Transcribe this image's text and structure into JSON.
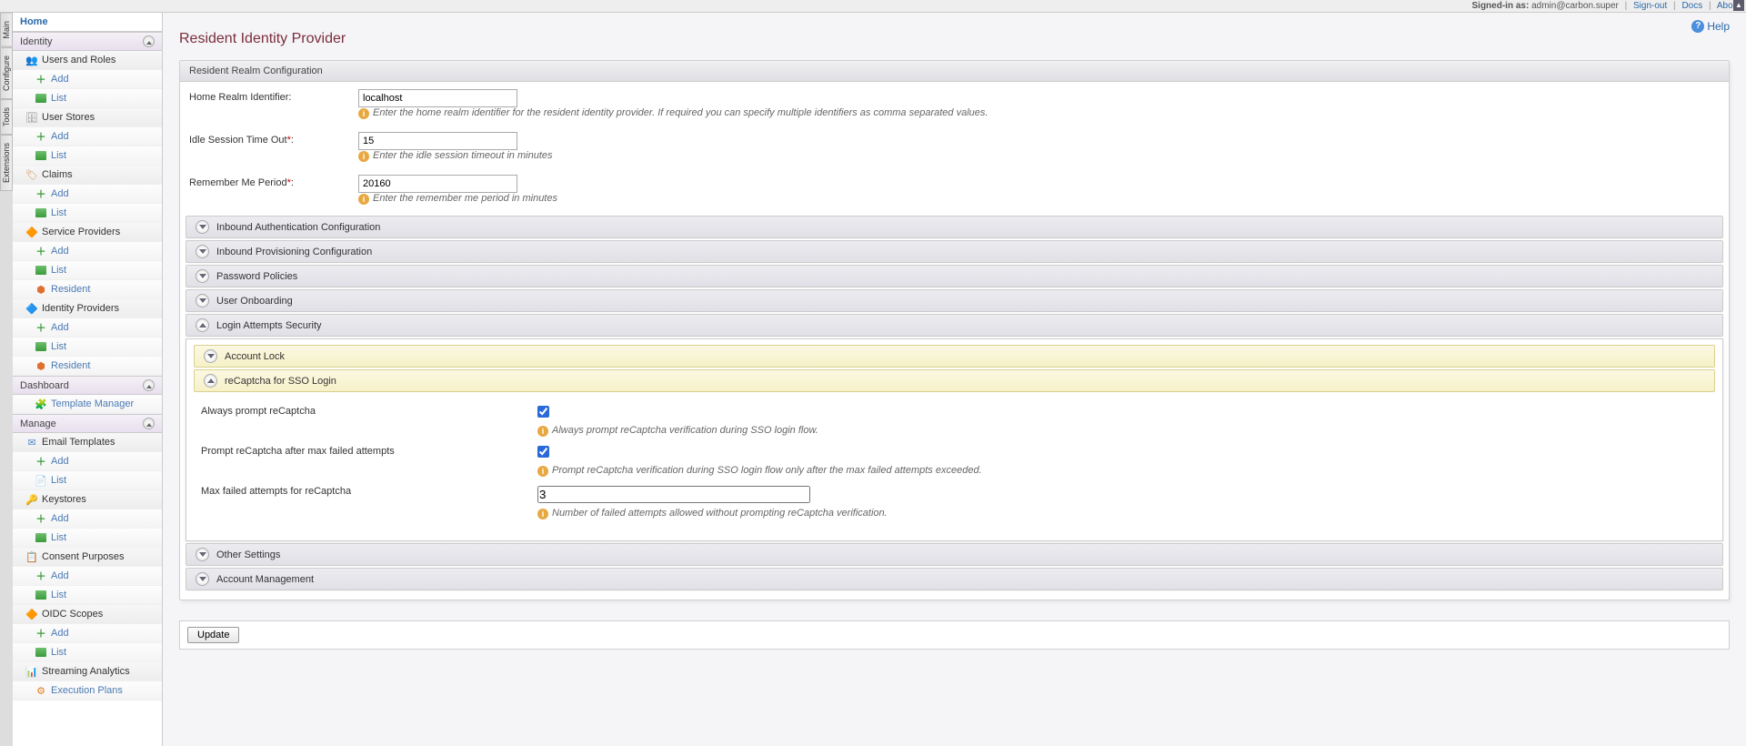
{
  "topbar": {
    "signed_in_label": "Signed-in as:",
    "user": "admin@carbon.super",
    "sign_out": "Sign-out",
    "docs": "Docs",
    "about": "About"
  },
  "breadcrumb": {
    "home": "Home"
  },
  "sidetabs": [
    "Main",
    "Configure",
    "Tools",
    "Extensions"
  ],
  "sidebar": {
    "identity": {
      "label": "Identity",
      "groups": [
        {
          "label": "Users and Roles",
          "items": [
            "Add",
            "List"
          ]
        },
        {
          "label": "User Stores",
          "items": [
            "Add",
            "List"
          ]
        },
        {
          "label": "Claims",
          "items": [
            "Add",
            "List"
          ]
        },
        {
          "label": "Service Providers",
          "items": [
            "Add",
            "List",
            "Resident"
          ]
        },
        {
          "label": "Identity Providers",
          "items": [
            "Add",
            "List",
            "Resident"
          ]
        }
      ]
    },
    "dashboard": {
      "label": "Dashboard",
      "items": [
        "Template Manager"
      ]
    },
    "manage": {
      "label": "Manage",
      "groups": [
        {
          "label": "Email Templates",
          "items": [
            "Add",
            "List"
          ]
        },
        {
          "label": "Keystores",
          "items": [
            "Add",
            "List"
          ]
        },
        {
          "label": "Consent Purposes",
          "items": [
            "Add",
            "List"
          ]
        },
        {
          "label": "OIDC Scopes",
          "items": [
            "Add",
            "List"
          ]
        },
        {
          "label": "Streaming Analytics",
          "items": [
            "Execution Plans"
          ]
        }
      ]
    }
  },
  "help_label": "Help",
  "page_title": "Resident Identity Provider",
  "panel_header": "Resident Realm Configuration",
  "form": {
    "home_realm": {
      "label": "Home Realm Identifier:",
      "value": "localhost",
      "hint": "Enter the home realm identifier for the resident identity provider. If required you can specify multiple identifiers as comma separated values."
    },
    "idle": {
      "label": "Idle Session Time Out",
      "value": "15",
      "hint": "Enter the idle session timeout in minutes"
    },
    "remember": {
      "label": "Remember Me Period",
      "value": "20160",
      "hint": "Enter the remember me period in minutes"
    }
  },
  "accordions": {
    "inbound_auth": "Inbound Authentication Configuration",
    "inbound_prov": "Inbound Provisioning Configuration",
    "password_pol": "Password Policies",
    "user_onboard": "User Onboarding",
    "login_attempts": "Login Attempts Security",
    "other": "Other Settings",
    "account_mgmt": "Account Management"
  },
  "login_sec": {
    "account_lock": "Account Lock",
    "recaptcha": "reCaptcha for SSO Login",
    "always_prompt": {
      "label": "Always prompt reCaptcha",
      "checked": true,
      "hint": "Always prompt reCaptcha verification during SSO login flow."
    },
    "after_max": {
      "label": "Prompt reCaptcha after max failed attempts",
      "checked": true,
      "hint": "Prompt reCaptcha verification during SSO login flow only after the max failed attempts exceeded."
    },
    "max_failed": {
      "label": "Max failed attempts for reCaptcha",
      "value": "3",
      "hint": "Number of failed attempts allowed without prompting reCaptcha verification."
    }
  },
  "update_btn": "Update"
}
